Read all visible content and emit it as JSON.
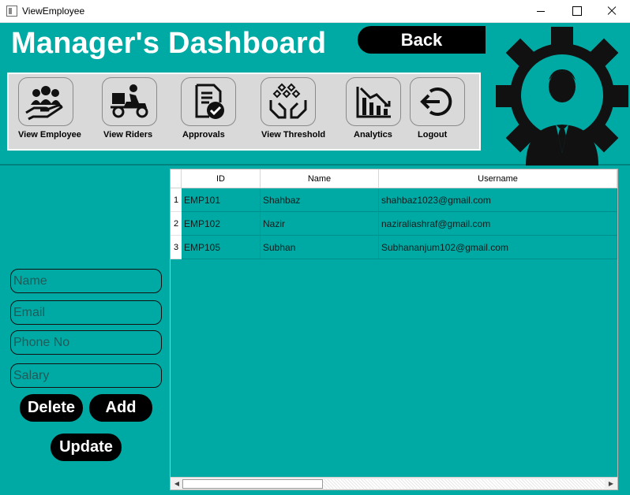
{
  "window": {
    "title": "ViewEmployee"
  },
  "header": {
    "title": "Manager's Dashboard",
    "back_label": "Back"
  },
  "toolbar": {
    "items": [
      {
        "label": "View Employee",
        "icon": "employees-hand-icon"
      },
      {
        "label": "View Riders",
        "icon": "delivery-rider-icon"
      },
      {
        "label": "Approvals",
        "icon": "approval-document-icon"
      },
      {
        "label": "View Threshold",
        "icon": "threshold-hands-icon"
      },
      {
        "label": "Analytics",
        "icon": "analytics-chart-icon"
      },
      {
        "label": "Logout",
        "icon": "logout-icon"
      }
    ]
  },
  "form": {
    "name_placeholder": "Name",
    "email_placeholder": "Email",
    "phone_placeholder": "Phone No",
    "salary_placeholder": "Salary",
    "delete_label": "Delete",
    "add_label": "Add",
    "update_label": "Update"
  },
  "table": {
    "columns": [
      "ID",
      "Name",
      "Username"
    ],
    "rows": [
      {
        "num": "1",
        "id": "EMP101",
        "name": "Shahbaz",
        "username": "shahbaz1023@gmail.com"
      },
      {
        "num": "2",
        "id": "EMP102",
        "name": "Nazir",
        "username": "naziraliashraf@gmail.com"
      },
      {
        "num": "3",
        "id": "EMP105",
        "name": "Subhan",
        "username": "Subhananjum102@gmail.com"
      }
    ]
  },
  "colors": {
    "teal": "#00aaa4",
    "black": "#000000",
    "toolbar_bg": "#d9d9d9"
  }
}
